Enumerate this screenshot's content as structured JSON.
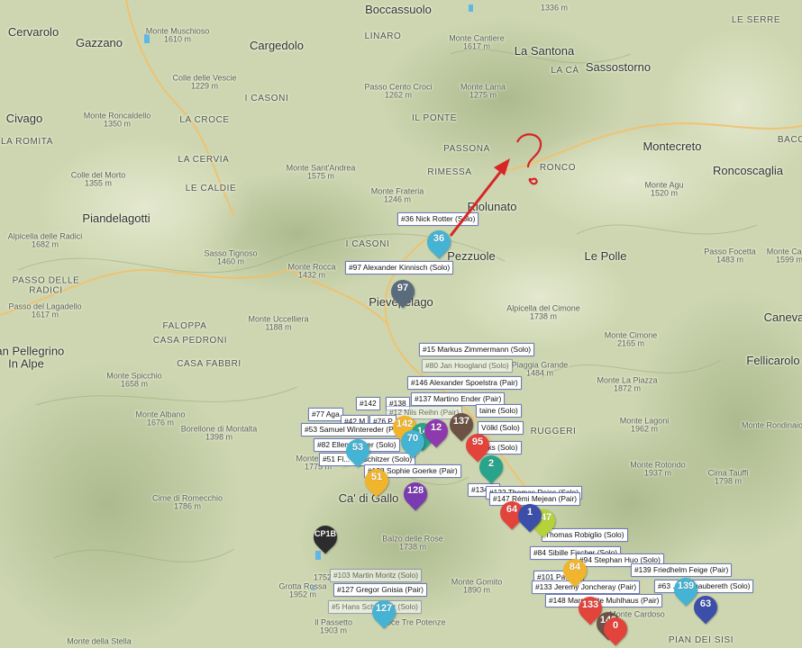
{
  "places": [
    {
      "id": "boccassuolo",
      "text": "Boccassuolo",
      "kind": "town"
    },
    {
      "id": "m1336",
      "text": "1336 m",
      "kind": "peak"
    },
    {
      "id": "cervarolo",
      "text": "Cervarolo",
      "kind": "town"
    },
    {
      "id": "gazzano",
      "text": "Gazzano",
      "kind": "town"
    },
    {
      "id": "muschioso",
      "text": "Monte Muschioso",
      "elev": "1610 m",
      "kind": "peak"
    },
    {
      "id": "cargedolo",
      "text": "Cargedolo",
      "kind": "town"
    },
    {
      "id": "linaro",
      "text": "LINARO",
      "kind": "hamlet"
    },
    {
      "id": "cantiere",
      "text": "Monte Cantiere",
      "elev": "1617 m",
      "kind": "peak"
    },
    {
      "id": "lasantona",
      "text": "La Santona",
      "kind": "town"
    },
    {
      "id": "leserre",
      "text": "LE SERRE",
      "kind": "hamlet"
    },
    {
      "id": "laca",
      "text": "LA CÀ",
      "kind": "hamlet"
    },
    {
      "id": "sassostorno",
      "text": "Sassostorno",
      "kind": "town"
    },
    {
      "id": "vescie",
      "text": "Colle delle Vescie",
      "elev": "1229 m",
      "kind": "peak"
    },
    {
      "id": "croci",
      "text": "Passo Cento Croci",
      "elev": "1262 m",
      "kind": "peak"
    },
    {
      "id": "lama",
      "text": "Monte Lama",
      "elev": "1275 m",
      "kind": "peak"
    },
    {
      "id": "icasoni1",
      "text": "I CASONI",
      "kind": "hamlet"
    },
    {
      "id": "civago",
      "text": "Civago",
      "kind": "town"
    },
    {
      "id": "roncaldello",
      "text": "Monte Roncaldello",
      "elev": "1350 m",
      "kind": "peak"
    },
    {
      "id": "lacroce",
      "text": "LA CROCE",
      "kind": "hamlet"
    },
    {
      "id": "ilponte",
      "text": "IL PONTE",
      "kind": "hamlet"
    },
    {
      "id": "laromita",
      "text": "LA ROMITA",
      "kind": "hamlet"
    },
    {
      "id": "passona",
      "text": "PASSONA",
      "kind": "hamlet"
    },
    {
      "id": "montecreto",
      "text": "Montecreto",
      "kind": "town"
    },
    {
      "id": "bacc",
      "text": "BACC",
      "kind": "hamlet"
    },
    {
      "id": "lacervia",
      "text": "LA CERVIA",
      "kind": "hamlet"
    },
    {
      "id": "rimessa",
      "text": "RIMESSA",
      "kind": "hamlet"
    },
    {
      "id": "ronco",
      "text": "RONCO",
      "kind": "hamlet"
    },
    {
      "id": "roncoscaglia",
      "text": "Roncoscaglia",
      "kind": "town"
    },
    {
      "id": "santandrea",
      "text": "Monte Sant'Andrea",
      "elev": "1575 m",
      "kind": "peak"
    },
    {
      "id": "collemorto",
      "text": "Colle del Morto",
      "elev": "1355 m",
      "kind": "peak"
    },
    {
      "id": "lecaldie",
      "text": "LE CALDIE",
      "kind": "hamlet"
    },
    {
      "id": "frateria",
      "text": "Monte Frateria",
      "elev": "1246 m",
      "kind": "peak"
    },
    {
      "id": "riolunato",
      "text": "Riolunato",
      "kind": "town"
    },
    {
      "id": "agu",
      "text": "Monte Agu",
      "elev": "1520 m",
      "kind": "peak"
    },
    {
      "id": "piandelagotti",
      "text": "Piandelagotti",
      "kind": "town"
    },
    {
      "id": "alpicella",
      "text": "Alpicella delle Radici",
      "elev": "1682 m",
      "kind": "peak"
    },
    {
      "id": "icasoni2",
      "text": "I CASONI",
      "kind": "hamlet"
    },
    {
      "id": "tignoso",
      "text": "Sasso Tignoso",
      "elev": "1460 m",
      "kind": "peak"
    },
    {
      "id": "pievepelago_lbl",
      "text": "Pezzuole",
      "kind": "town"
    },
    {
      "id": "lepolle",
      "text": "Le Polle",
      "kind": "town"
    },
    {
      "id": "passofocetta",
      "text": "Passo Focetta",
      "elev": "1483 m",
      "kind": "peak"
    },
    {
      "id": "calvario",
      "text": "Monte Calva",
      "elev": "1599 m",
      "kind": "peak"
    },
    {
      "id": "passoradici",
      "text": "PASSO DELLE\nRADICI",
      "kind": "hamlet"
    },
    {
      "id": "rocca",
      "text": "Monte Rocca",
      "elev": "1432 m",
      "kind": "peak"
    },
    {
      "id": "lagadello",
      "text": "Passo del Lagadello",
      "elev": "1617 m",
      "kind": "peak"
    },
    {
      "id": "pievepelago",
      "text": "Pievepelago",
      "kind": "town"
    },
    {
      "id": "cimone",
      "text": "Alpicella del Cimone",
      "elev": "1738 m",
      "kind": "peak"
    },
    {
      "id": "caneva",
      "text": "Caneva",
      "kind": "town"
    },
    {
      "id": "falpoppa",
      "text": "FALOPPA",
      "kind": "hamlet"
    },
    {
      "id": "uccelliera",
      "text": "Monte Uccelliera",
      "elev": "1188 m",
      "kind": "peak"
    },
    {
      "id": "cimone2",
      "text": "Monte Cimone",
      "elev": "2165 m",
      "kind": "peak"
    },
    {
      "id": "pellegrino",
      "text": "San Pellegrino\nIn Alpe",
      "kind": "town"
    },
    {
      "id": "pedroni",
      "text": "CASA PEDRONI",
      "kind": "hamlet"
    },
    {
      "id": "fellicarolo",
      "text": "Fellicarolo",
      "kind": "town"
    },
    {
      "id": "fabbri",
      "text": "CASA FABBRI",
      "kind": "hamlet"
    },
    {
      "id": "spicchio",
      "text": "Monte Spicchio",
      "elev": "1658 m",
      "kind": "peak"
    },
    {
      "id": "piaggia",
      "text": "Piaggia Grande",
      "elev": "1484 m",
      "kind": "peak"
    },
    {
      "id": "laPiazza",
      "text": "Monte La Piazza",
      "elev": "1872 m",
      "kind": "peak"
    },
    {
      "id": "albano",
      "text": "Monte Albano",
      "elev": "1676 m",
      "kind": "peak"
    },
    {
      "id": "montalta",
      "text": "Borellone di Montalta",
      "elev": "1398 m",
      "kind": "peak"
    },
    {
      "id": "ruggeri",
      "text": "RUGGERI",
      "kind": "hamlet"
    },
    {
      "id": "lagoni",
      "text": "Monte Lagoni",
      "elev": "1962 m",
      "kind": "peak"
    },
    {
      "id": "rondine",
      "text": "Monte Rondinaio",
      "elev": "",
      "kind": "peak"
    },
    {
      "id": "nuda",
      "text": "Monte Nuda",
      "elev": "1775 m",
      "kind": "peak"
    },
    {
      "id": "cadigallo",
      "text": "Ca' di Gallo",
      "kind": "town"
    },
    {
      "id": "rotondo",
      "text": "Monte Rotondo",
      "elev": "1937 m",
      "kind": "peak"
    },
    {
      "id": "tauffi",
      "text": "Cima Tauffi",
      "elev": "1798 m",
      "kind": "peak"
    },
    {
      "id": "romecchio",
      "text": "Cime di Romecchio",
      "elev": "1786 m",
      "kind": "peak"
    },
    {
      "id": "rose",
      "text": "Balzo delle Rose",
      "elev": "1738 m",
      "kind": "peak"
    },
    {
      "id": "m1752",
      "text": "1752",
      "kind": "peak"
    },
    {
      "id": "grottarossa",
      "text": "Grotta Rossa",
      "elev": "1952 m",
      "kind": "peak"
    },
    {
      "id": "gomito",
      "text": "Monte Gomito",
      "elev": "1890 m",
      "kind": "peak"
    },
    {
      "id": "passetto",
      "text": "Il Passetto",
      "elev": "1903 m",
      "kind": "peak"
    },
    {
      "id": "focetta",
      "text": "Foce Tre Potenze",
      "kind": "peak"
    },
    {
      "id": "carodoso",
      "text": "Monte Cardoso",
      "elev": "",
      "kind": "peak"
    },
    {
      "id": "stella",
      "text": "Monte della Stella",
      "kind": "peak"
    },
    {
      "id": "piandeisisi",
      "text": "PIAN DEI SISI",
      "kind": "hamlet"
    }
  ],
  "labels": [
    {
      "id": "l36",
      "text": "#36 Nick Rotter (Solo)"
    },
    {
      "id": "l97",
      "text": "#97 Alexander Kinnisch (Solo)"
    },
    {
      "id": "l15",
      "text": "#15 Markus Zimmermann (Solo)"
    },
    {
      "id": "l80",
      "text": "#80 Jan Hoogland (Solo)",
      "faded": true
    },
    {
      "id": "l146",
      "text": "#146 Alexander Spoelstra (Pair)"
    },
    {
      "id": "l137",
      "text": "#137 Martino Ender (Pair)"
    },
    {
      "id": "l142",
      "text": "#142"
    },
    {
      "id": "l138",
      "text": "#138"
    },
    {
      "id": "l12",
      "text": "#12 Nils Reihn (Pair)",
      "faded": true
    },
    {
      "id": "l77",
      "text": "#77 Aga"
    },
    {
      "id": "l42",
      "text": "#42 M"
    },
    {
      "id": "l76",
      "text": "#76 P"
    },
    {
      "id": "lstaine",
      "text": "taine (Solo)"
    },
    {
      "id": "lvoekl",
      "text": "Völkl (Solo)"
    },
    {
      "id": "l53",
      "text": "#53 Samuel Wintereder (Pair)"
    },
    {
      "id": "l82",
      "text": "#82 Ellen Rohrer (Solo)"
    },
    {
      "id": "lmarks",
      "text": "arks (Solo)"
    },
    {
      "id": "l51",
      "text": "#51 Fl... Kraschitzer (Solo)"
    },
    {
      "id": "l128",
      "text": "#128 Sophie Goerke (Pair)"
    },
    {
      "id": "l134",
      "text": "#134 ..."
    },
    {
      "id": "l122",
      "text": "#122 Thomas Reiss (Solo)"
    },
    {
      "id": "l147",
      "text": "#147 Rémi Mejean (Pair)"
    },
    {
      "id": "lrobi",
      "text": "Thomas Robiglio (Solo)"
    },
    {
      "id": "l84",
      "text": "#84 Sibille Fischer (Solo)"
    },
    {
      "id": "l94",
      "text": "#94 Stephan Huo (Solo)"
    },
    {
      "id": "l139",
      "text": "#139 Friedhelm Feige (Pair)"
    },
    {
      "id": "l101",
      "text": "#101 Pa... ..."
    },
    {
      "id": "l63",
      "text": "#63 ... Schnaubereth (Solo)"
    },
    {
      "id": "l103",
      "text": "#103 Martin Moritz (Solo)",
      "faded": true
    },
    {
      "id": "l127",
      "text": "#127 Gregor Gnisia (Pair)"
    },
    {
      "id": "l133",
      "text": "#133 Jeremy Joncheray (Pair)"
    },
    {
      "id": "l5",
      "text": "#5 Hans Schneider (Solo)",
      "faded": true
    },
    {
      "id": "l148",
      "text": "#148 Marguerite Muhlhaus (Pair)"
    }
  ],
  "pins": [
    {
      "id": "p36",
      "num": "36",
      "color": "#45b3d3"
    },
    {
      "id": "p97",
      "num": "97",
      "color": "#5a6b7c"
    },
    {
      "id": "p142",
      "num": "142",
      "color": "#f0b52c"
    },
    {
      "id": "p14",
      "num": "14",
      "color": "#28a48a"
    },
    {
      "id": "p12",
      "num": "12",
      "color": "#8e3aad"
    },
    {
      "id": "p137",
      "num": "137",
      "color": "#6b5245"
    },
    {
      "id": "p70",
      "num": "70",
      "color": "#45b3d3"
    },
    {
      "id": "p53",
      "num": "53",
      "color": "#45b3d3"
    },
    {
      "id": "p95",
      "num": "95",
      "color": "#e2443c"
    },
    {
      "id": "p2",
      "num": "2",
      "color": "#28a48a"
    },
    {
      "id": "p51",
      "num": "51",
      "color": "#f0b52c"
    },
    {
      "id": "p128",
      "num": "128",
      "color": "#7a3ab0"
    },
    {
      "id": "p64",
      "num": "64",
      "color": "#e2443c"
    },
    {
      "id": "p147",
      "num": "147",
      "color": "#b6d23a"
    },
    {
      "id": "p1",
      "num": "1",
      "color": "#3c4fa8"
    },
    {
      "id": "pCP1B",
      "num": "CP1B",
      "color": "#2c2c2c"
    },
    {
      "id": "p84",
      "num": "84",
      "color": "#f0b52c"
    },
    {
      "id": "p139",
      "num": "139",
      "color": "#45b3d3"
    },
    {
      "id": "p63",
      "num": "63",
      "color": "#3c4fa8"
    },
    {
      "id": "p133",
      "num": "133",
      "color": "#e2443c"
    },
    {
      "id": "p148",
      "num": "148",
      "color": "#6b5245"
    },
    {
      "id": "p127",
      "num": "127",
      "color": "#45b3d3"
    },
    {
      "id": "p0",
      "num": "0",
      "color": "#e2443c"
    }
  ],
  "colors": {
    "terrain": "#cfd8b3",
    "road": "#f2c06a",
    "water": "#5fb7e6",
    "arrow": "#d62525",
    "label_border": "#6e7bb8"
  }
}
